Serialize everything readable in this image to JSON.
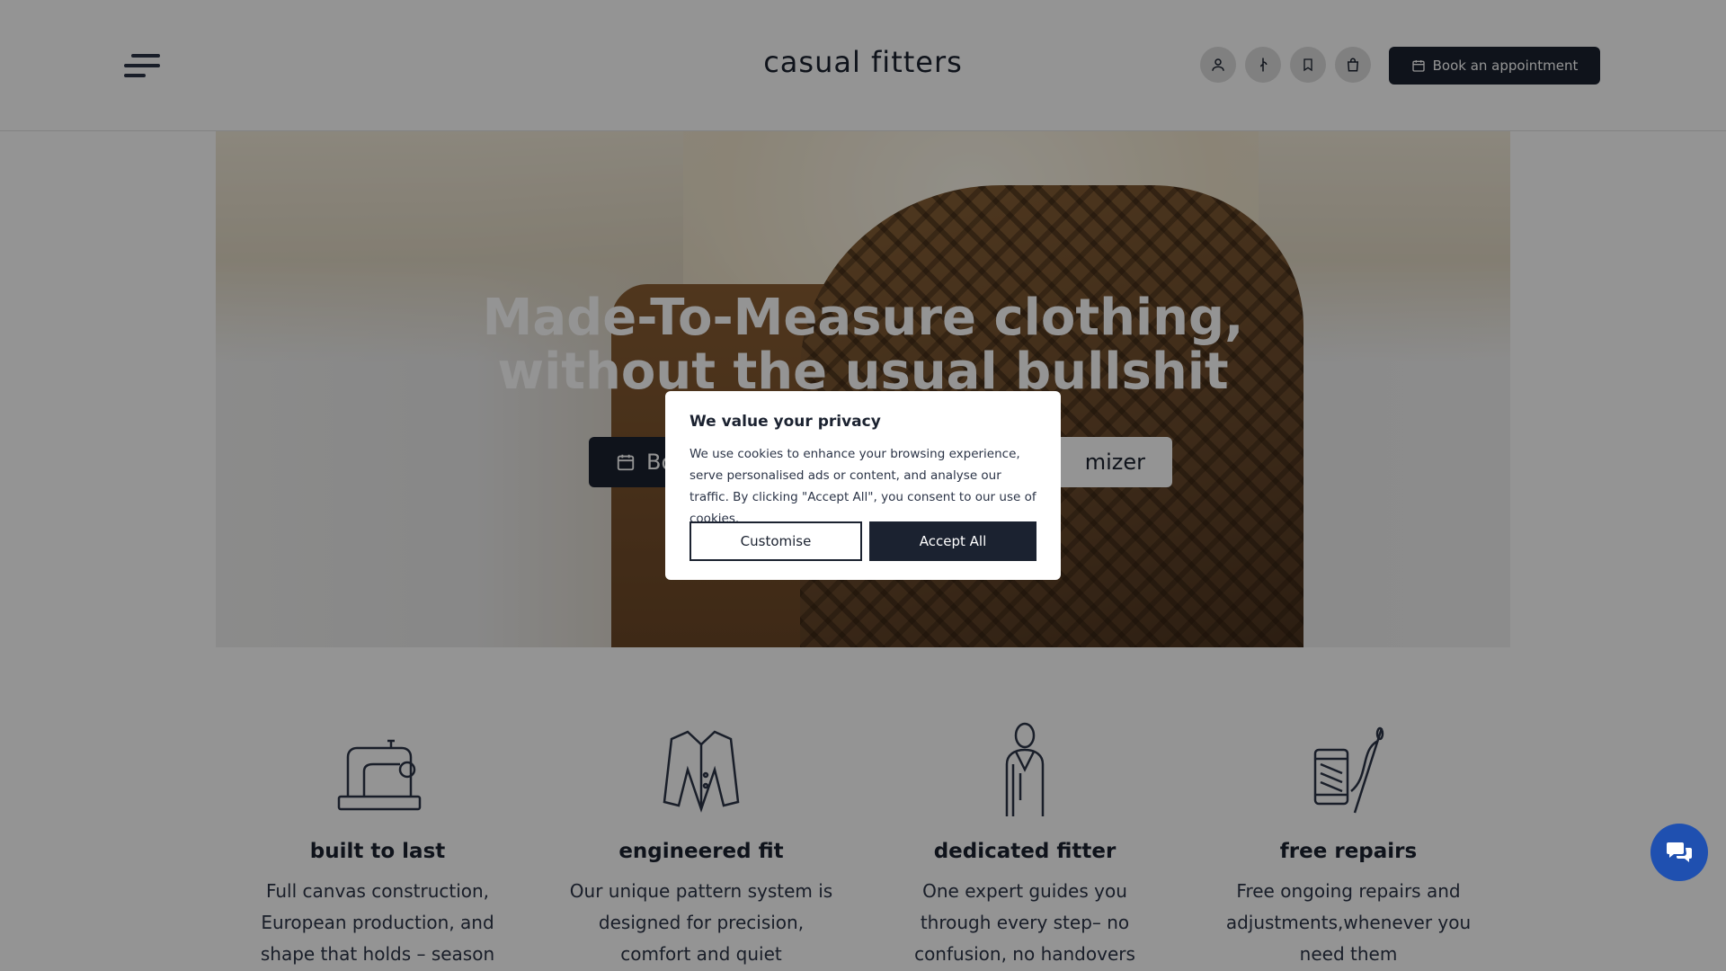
{
  "header": {
    "logo": "casual fitters",
    "menu_icon": "hamburger-menu-icon",
    "icons": [
      "user-icon",
      "measuring-icon",
      "bookmark-icon",
      "shopping-bag-icon"
    ],
    "book_label": "Book an appointment"
  },
  "hero": {
    "title_line1": "Made-To-Measure clothing,",
    "title_line2": "without the usual bullshit",
    "primary_visible": "Bo",
    "secondary_visible": "mizer"
  },
  "features": [
    {
      "icon": "sewing-machine-icon",
      "title": "built to last",
      "text": "Full canvas construction, European production, and shape that holds – season"
    },
    {
      "icon": "suit-jacket-icon",
      "title": "engineered fit",
      "text": "Our unique pattern system is designed for precision, comfort and quiet"
    },
    {
      "icon": "fitter-person-icon",
      "title": "dedicated fitter",
      "text": "One expert guides you through every step– no confusion, no handovers"
    },
    {
      "icon": "thread-needle-icon",
      "title": "free repairs",
      "text": "Free ongoing repairs and adjustments,whenever you need them"
    }
  ],
  "cookie": {
    "title": "We value your privacy",
    "text": "We use cookies to enhance your browsing experience, serve personalised ads or content, and analyse our traffic. By clicking \"Accept All\", you consent to our use of cookies.",
    "customise_label": "Customise",
    "accept_label": "Accept All"
  },
  "chat": {
    "icon": "chat-bubbles-icon"
  },
  "colors": {
    "navy": "#1b2230",
    "chat_blue": "#1f50b0"
  }
}
